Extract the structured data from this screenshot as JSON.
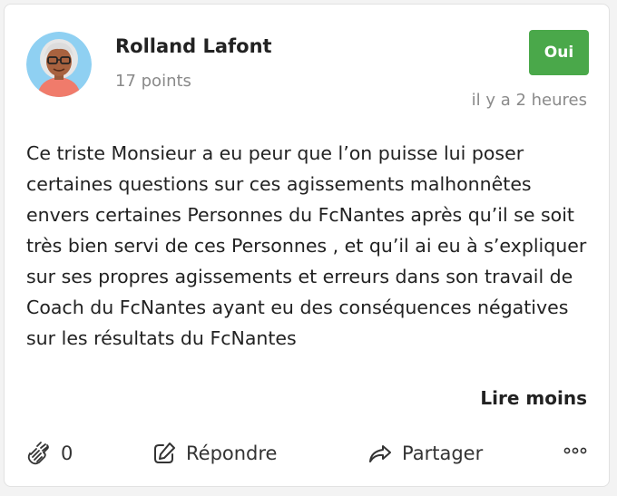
{
  "post": {
    "author": {
      "name": "Rolland Lafont",
      "points": "17 points",
      "avatar": "avatar-illustration"
    },
    "badge": {
      "label": "Oui",
      "color": "#4aa84a"
    },
    "timestamp": "il y a 2 heures",
    "body": "Ce triste Monsieur a eu peur que l’on puisse lui poser certaines questions sur ces agissements malhonnêtes envers certaines Personnes du FcNantes après qu’il se soit très bien servi de ces Personnes , et qu’il ai eu à s’expliquer sur ses propres agissements et erreurs dans son travail de Coach du FcNantes ayant eu des conséquences négatives sur les résultats du FcNantes",
    "read_less_label": "Lire moins"
  },
  "actions": {
    "clap": {
      "icon": "clap-icon",
      "count": "0"
    },
    "reply": {
      "icon": "edit-icon",
      "label": "Répondre"
    },
    "share": {
      "icon": "share-arrow-icon",
      "label": "Partager"
    },
    "more": {
      "icon": "more-dots-icon"
    }
  }
}
